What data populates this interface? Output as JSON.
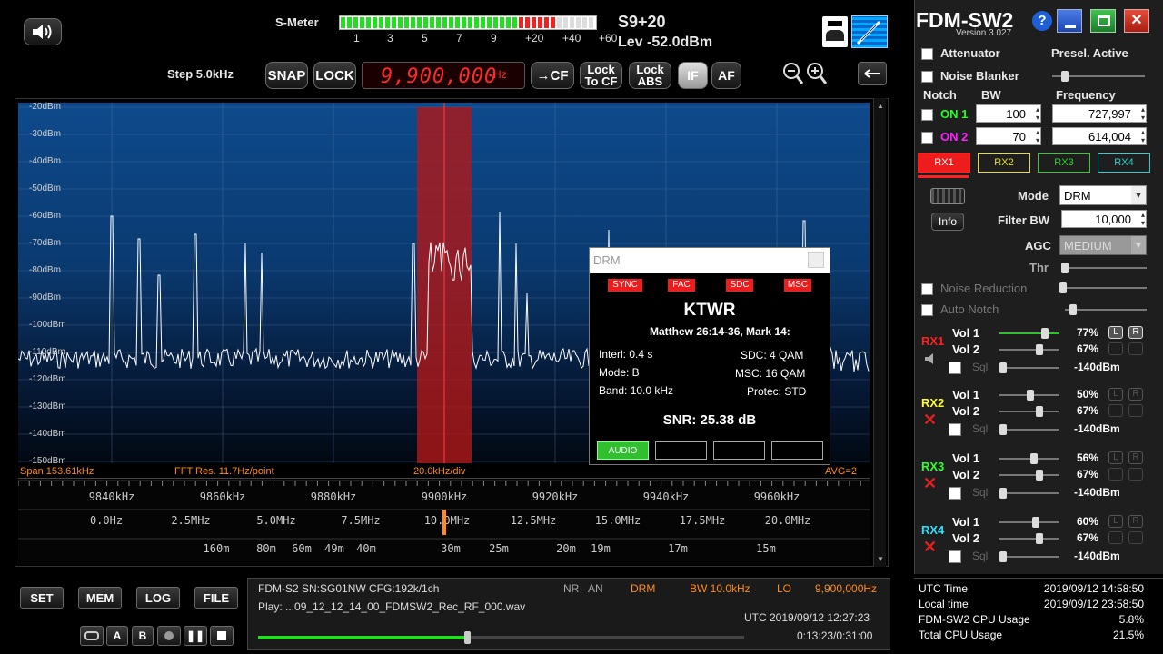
{
  "top": {
    "smeter_label": "S-Meter",
    "scale": [
      "1",
      "3",
      "5",
      "7",
      "9",
      "+20",
      "+40",
      "+60"
    ],
    "s_reading": "S9+20",
    "level": "Lev -52.0dBm",
    "step": "Step 5.0kHz",
    "snap": "SNAP",
    "lock": "LOCK",
    "frequency": "9,900,000",
    "freq_unit": "Hz",
    "cf": "→CF",
    "lock_to_cf": "Lock To CF",
    "lock_abs": "Lock ABS",
    "if": "IF",
    "af": "AF"
  },
  "spectrum": {
    "db_labels": [
      "-20dBm",
      "-30dBm",
      "-40dBm",
      "-50dBm",
      "-60dBm",
      "-70dBm",
      "-80dBm",
      "-90dBm",
      "-100dBm",
      "-110dBm",
      "-120dBm",
      "-130dBm",
      "-140dBm",
      "-150dBm"
    ],
    "span": "Span 153.61kHz",
    "fft": "FFT Res. 11.7Hz/point",
    "div": "20.0kHz/div",
    "avg": "AVG=2",
    "khz_ticks": [
      "9840kHz",
      "9860kHz",
      "9880kHz",
      "9900kHz",
      "9920kHz",
      "9940kHz",
      "9960kHz"
    ],
    "mhz_ticks": [
      "0.0Hz",
      "2.5MHz",
      "5.0MHz",
      "7.5MHz",
      "10.0MHz",
      "12.5MHz",
      "15.0MHz",
      "17.5MHz",
      "20.0MHz"
    ],
    "band_ticks": [
      "160m",
      "80m",
      "60m",
      "49m",
      "40m",
      "30m",
      "25m",
      "20m",
      "19m",
      "17m",
      "15m"
    ]
  },
  "drm": {
    "title": "DRM",
    "indicators": [
      "SYNC",
      "FAC",
      "SDC",
      "MSC"
    ],
    "station": "KTWR",
    "text": "Matthew 26:14-36, Mark 14:",
    "interl": "Interl: 0.4 s",
    "mode": "Mode: B",
    "band": "Band: 10.0 kHz",
    "sdc": "SDC:  4 QAM",
    "msc": "MSC: 16 QAM",
    "protec": "Protec: STD",
    "snr": "SNR: 25.38 dB",
    "audio": "AUDIO"
  },
  "bottom": {
    "set": "SET",
    "mem": "MEM",
    "log": "LOG",
    "file": "FILE",
    "a": "A",
    "b": "B",
    "device": "FDM-S2 SN:SG01NW  CFG:192k/1ch",
    "nr": "NR",
    "an": "AN",
    "mode": "DRM",
    "bw": "BW 10.0kHz",
    "lo": "LO",
    "lo_freq": "9,900,000Hz",
    "play": "Play: ...09_12_12_14_00_FDMSW2_Rec_RF_000.wav",
    "utc": "UTC 2019/09/12 12:27:23",
    "time": "0:13:23/0:31:00",
    "play_progress": 0.43
  },
  "panel": {
    "title": "FDM-SW2",
    "version": "Version 3.027",
    "attenuator": "Attenuator",
    "presel": "Presel. Active",
    "noise_blanker": "Noise Blanker",
    "notch": "Notch",
    "bw": "BW",
    "frequency": "Frequency",
    "on1": "ON 1",
    "on2": "ON 2",
    "bw1": "100",
    "bw2": "70",
    "f1": "727,997",
    "f2": "614,004",
    "rx_tabs": [
      "RX1",
      "RX2",
      "RX3",
      "RX4"
    ],
    "mode_label": "Mode",
    "mode": "DRM",
    "filter_bw_label": "Filter BW",
    "filter_bw": "10,000",
    "agc_label": "AGC",
    "agc": "MEDIUM",
    "thr": "Thr",
    "info": "Info",
    "noise_reduction": "Noise Reduction",
    "auto_notch": "Auto Notch",
    "receivers": [
      {
        "name": "RX1",
        "vol1": "77%",
        "vol2": "67%",
        "sql": "-140dBm",
        "color": "#ff2020"
      },
      {
        "name": "RX2",
        "vol1": "50%",
        "vol2": "67%",
        "sql": "-140dBm",
        "color": "#ffff30"
      },
      {
        "name": "RX3",
        "vol1": "56%",
        "vol2": "67%",
        "sql": "-140dBm",
        "color": "#30ff30"
      },
      {
        "name": "RX4",
        "vol1": "60%",
        "vol2": "67%",
        "sql": "-140dBm",
        "color": "#30e0ff"
      }
    ],
    "vol1": "Vol 1",
    "vol2": "Vol 2",
    "sql": "Sql",
    "l": "L",
    "r": "R"
  },
  "status": {
    "utc_label": "UTC Time",
    "utc": "2019/09/12 14:58:50",
    "local_label": "Local time",
    "local": "2019/09/12 23:58:50",
    "cpu_label": "FDM-SW2 CPU Usage",
    "cpu": "5.8%",
    "total_label": "Total CPU Usage",
    "total": "21.5%"
  }
}
